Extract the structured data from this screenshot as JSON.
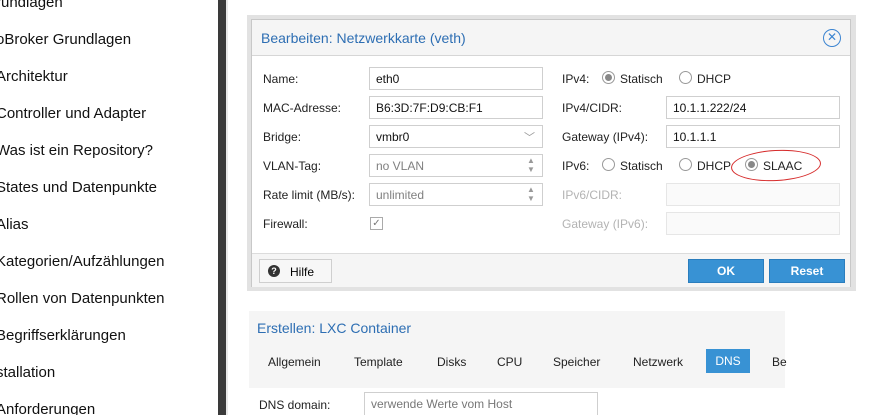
{
  "sidebar": {
    "items": [
      "rundlagen",
      "oBroker Grundlagen",
      "Architektur",
      "Controller und Adapter",
      "Was ist ein Repository?",
      "States und Datenpunkte",
      "Alias",
      "Kategorien/Aufzählungen",
      "Rollen von Datenpunkten",
      "Begriffserklärungen",
      "stallation",
      "Anforderungen"
    ]
  },
  "dialog": {
    "title": "Bearbeiten: Netzwerkkarte (veth)",
    "name_label": "Name:",
    "name_value": "eth0",
    "mac_label": "MAC-Adresse:",
    "mac_value": "B6:3D:7F:D9:CB:F1",
    "bridge_label": "Bridge:",
    "bridge_value": "vmbr0",
    "vlan_label": "VLAN-Tag:",
    "vlan_value": "no VLAN",
    "rate_label": "Rate limit (MB/s):",
    "rate_value": "unlimited",
    "firewall_label": "Firewall:",
    "ipv4_label": "IPv4:",
    "ipv4_static": "Statisch",
    "ipv4_dhcp": "DHCP",
    "ipv4_cidr_label": "IPv4/CIDR:",
    "ipv4_cidr_value": "10.1.1.222/24",
    "gateway4_label": "Gateway (IPv4):",
    "gateway4_value": "10.1.1.1",
    "ipv6_label": "IPv6:",
    "ipv6_static": "Statisch",
    "ipv6_dhcp": "DHCP",
    "ipv6_slaac": "SLAAC",
    "ipv6_cidr_label": "IPv6/CIDR:",
    "gateway6_label": "Gateway (IPv6):",
    "help_label": "Hilfe",
    "ok_label": "OK",
    "reset_label": "Reset"
  },
  "create_panel": {
    "title": "Erstellen: LXC Container",
    "tabs": [
      "Allgemein",
      "Template",
      "Disks",
      "CPU",
      "Speicher",
      "Netzwerk",
      "DNS",
      "Be"
    ],
    "active_tab": "DNS",
    "dns_domain_label": "DNS domain:",
    "dns_domain_value": "verwende Werte vom Host"
  },
  "colors": {
    "accent": "#3892d4",
    "title_blue": "#2d6eb3",
    "annotation_red": "#d62c2c"
  }
}
